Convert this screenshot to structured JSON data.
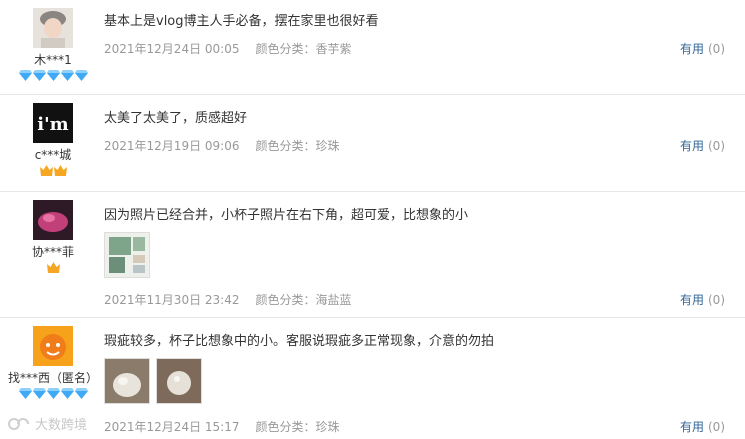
{
  "reviews": [
    {
      "username": "木***1",
      "badge": "diamond",
      "badge_count": 5,
      "text": "基本上是vlog博主人手必备，摆在家里也很好看",
      "date": "2021年12月24日 00:05",
      "color_label": "颜色分类：",
      "color_value": "香芋紫",
      "helpful_label": "有用",
      "helpful_count": "(0)",
      "avatar_desc": "portrait-photo"
    },
    {
      "username": "c***城",
      "badge": "crown",
      "badge_count": 2,
      "text": "太美了太美了，质感超好",
      "date": "2021年12月19日 09:06",
      "color_label": "颜色分类：",
      "color_value": "珍珠",
      "helpful_label": "有用",
      "helpful_count": "(0)",
      "avatar_desc": "im-logo",
      "avatar_text": "i'm"
    },
    {
      "username": "协***菲",
      "badge": "crown",
      "badge_count": 1,
      "text": "因为照片已经合并，小杯子照片在右下角，超可爱，比想象的小",
      "date": "2021年11月30日 23:42",
      "color_label": "颜色分类：",
      "color_value": "海盐蓝",
      "helpful_label": "有用",
      "helpful_count": "(0)",
      "avatar_desc": "pink-photo"
    },
    {
      "username": "找***西（匿名）",
      "badge": "diamond",
      "badge_count": 5,
      "text": "瑕疵较多，杯子比想象中的小。客服说瑕疵多正常现象，介意的勿拍",
      "date": "2021年12月24日 15:17",
      "color_label": "颜色分类：",
      "color_value": "珍珠",
      "helpful_label": "有用",
      "helpful_count": "(0)",
      "avatar_desc": "orange-cartoon"
    }
  ],
  "watermark": "大数跨境",
  "colors": {
    "helpful": "#336699",
    "meta": "#999999",
    "diamond": "#3fa9f5",
    "crown": "#f5a623"
  }
}
